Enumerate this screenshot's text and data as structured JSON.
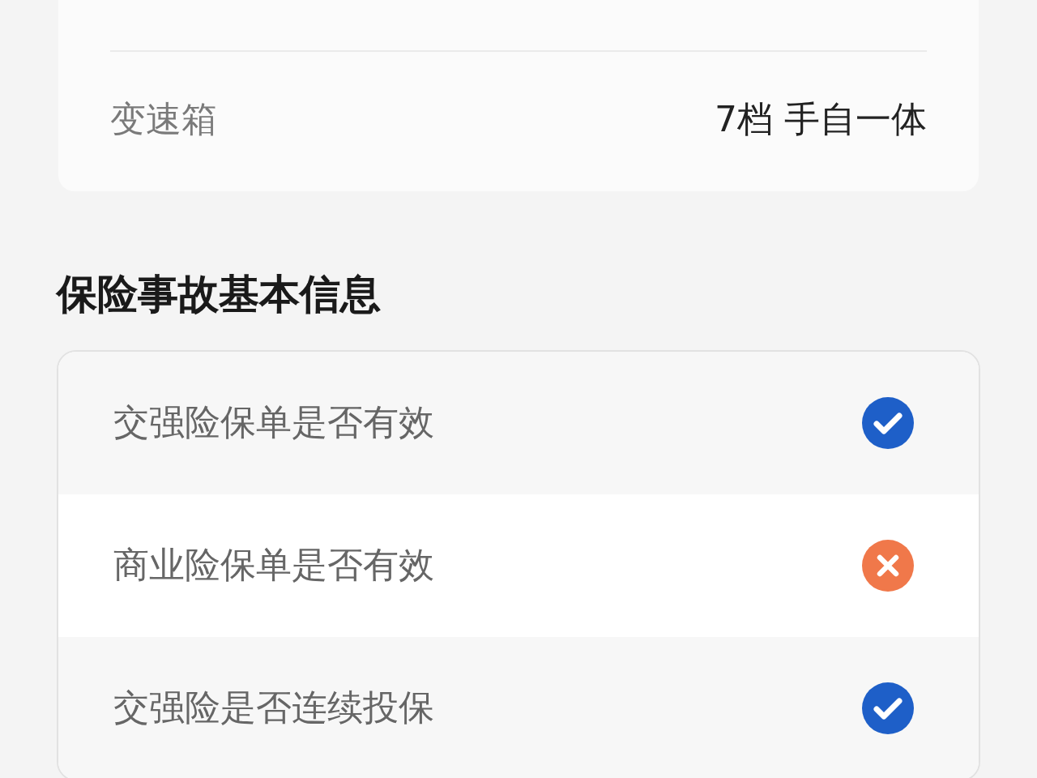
{
  "vehicle_info": {
    "rows": [
      {
        "label": "变速箱",
        "value": "7档 手自一体"
      }
    ]
  },
  "accident_info": {
    "title": "保险事故基本信息",
    "rows": [
      {
        "label": "交强险保单是否有效",
        "valid": true
      },
      {
        "label": "商业险保单是否有效",
        "valid": false
      },
      {
        "label": "交强险是否连续投保",
        "valid": true
      }
    ]
  }
}
